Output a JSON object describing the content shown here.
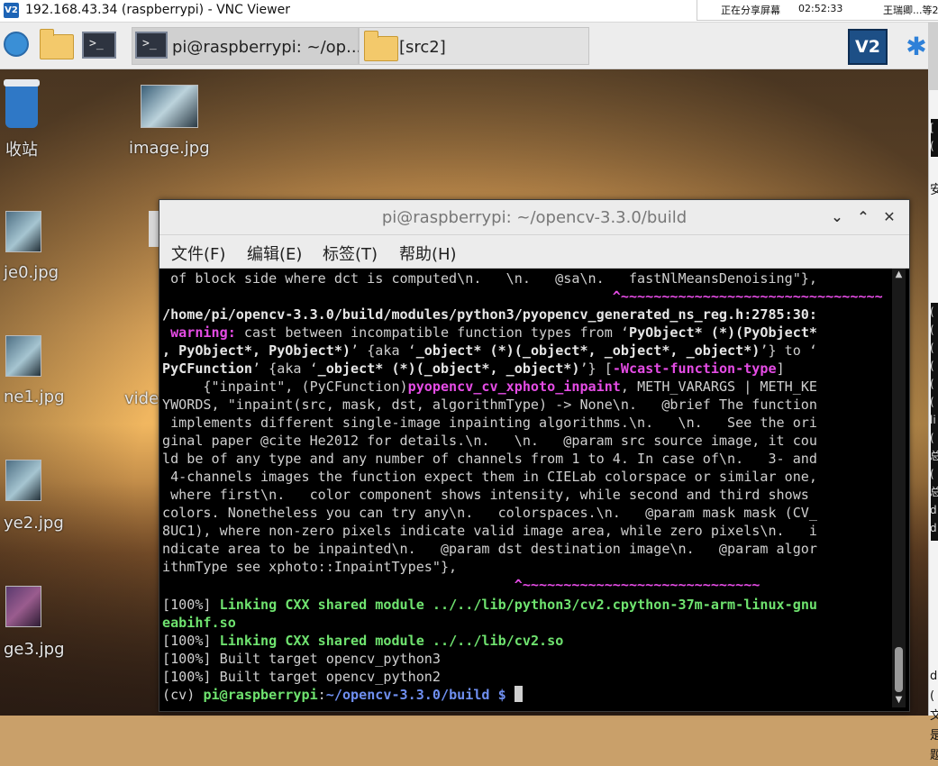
{
  "vnc": {
    "title": "192.168.43.34 (raspberrypi) - VNC Viewer",
    "logo_text": "V2",
    "share_status": "正在分享屏幕",
    "time": "02:52:33",
    "user": "王瑞卿...等2"
  },
  "panel": {
    "task_terminal": "pi@raspberrypi: ~/op...",
    "task_folder": "[src2]",
    "vnc_icon_text": "V2",
    "bluetooth_glyph": "✱"
  },
  "desktop": {
    "icons": [
      {
        "label": "收站"
      },
      {
        "label": "image.jpg"
      },
      {
        "label": "je0.jpg"
      },
      {
        "label": "ne1.jpg"
      },
      {
        "label": "vide"
      },
      {
        "label": "ye2.jpg"
      },
      {
        "label": "ge3.jpg"
      }
    ]
  },
  "right_strip": [
    "[",
    "(",
    "安",
    "(",
    "(",
    "(",
    "(",
    "(",
    "(",
    "li",
    "(",
    "总",
    "(",
    "总",
    "d",
    "d",
    "d",
    "(",
    "文",
    "是",
    "题"
  ],
  "terminal": {
    "title": "pi@raspberrypi: ~/opencv-3.3.0/build",
    "btn_min": "⌄",
    "btn_max": "⌃",
    "btn_close": "✕",
    "menu": [
      "文件(F)",
      "编辑(E)",
      "标签(T)",
      "帮助(H)"
    ],
    "lines": {
      "l1": " of block side where dct is computed\\n.   \\n.   @sa\\n.   fastNlMeansDenoising\"},",
      "l2": "                                                       ^~~~~~~~~~~~~~~~~~~~~~~~~~~~~~~~~",
      "l3": "/home/pi/opencv-3.3.0/build/modules/python3/pyopencv_generated_ns_reg.h:2785:30:",
      "l4_warn": " warning:",
      "l4_rest": " cast between incompatible function types from ‘",
      "l4_b": "PyObject* (*)(PyObject*",
      "l5_a": ", PyObject*, PyObject*)",
      "l5_b": "’ {aka ‘",
      "l5_c": "_object* (*)(_object*, _object*, _object*)",
      "l5_d": "’} to ‘",
      "l6_a": "PyCFunction",
      "l6_b": "’ {aka ‘",
      "l6_c": "_object* (*)(_object*, _object*)",
      "l6_d": "’} [",
      "l6_e": "-Wcast-function-type",
      "l6_f": "]",
      "l7_a": "     {\"inpaint\", (PyCFunction)",
      "l7_b": "pyopencv_cv_xphoto_inpaint",
      "l7_c": ", METH_VARARGS | METH_KE",
      "l8": "YWORDS, \"inpaint(src, mask, dst, algorithmType) -> None\\n.   @brief The function",
      "l9": " implements different single-image inpainting algorithms.\\n.   \\n.   See the ori",
      "l10": "ginal paper @cite He2012 for details.\\n.   \\n.   @param src source image, it cou",
      "l11": "ld be of any type and any number of channels from 1 to 4. In case of\\n.   3- and",
      "l12": " 4-channels images the function expect them in CIELab colorspace or similar one,",
      "l13": " where first\\n.   color component shows intensity, while second and third shows",
      "l14": "colors. Nonetheless you can try any\\n.   colorspaces.\\n.   @param mask mask (CV_",
      "l15": "8UC1), where non-zero pixels indicate valid image area, while zero pixels\\n.   i",
      "l16": "ndicate area to be inpainted\\n.   @param dst destination image\\n.   @param algor",
      "l17": "ithmType see xphoto::InpaintTypes\"},",
      "l18": "                                           ^~~~~~~~~~~~~~~~~~~~~~~~~~~~~~",
      "l19_a": "[100%] ",
      "l19_b": "Linking CXX shared module ../../lib/python3/cv2.cpython-37m-arm-linux-gnu",
      "l20": "eabihf.so",
      "l21_a": "[100%] ",
      "l21_b": "Linking CXX shared module ../../lib/cv2.so",
      "l22": "[100%] Built target opencv_python3",
      "l23": "[100%] Built target opencv_python2",
      "l24_a": "(cv) ",
      "l24_b": "pi@raspberrypi",
      "l24_c": ":",
      "l24_d": "~/opencv-3.3.0/build $",
      "l24_e": " "
    }
  }
}
